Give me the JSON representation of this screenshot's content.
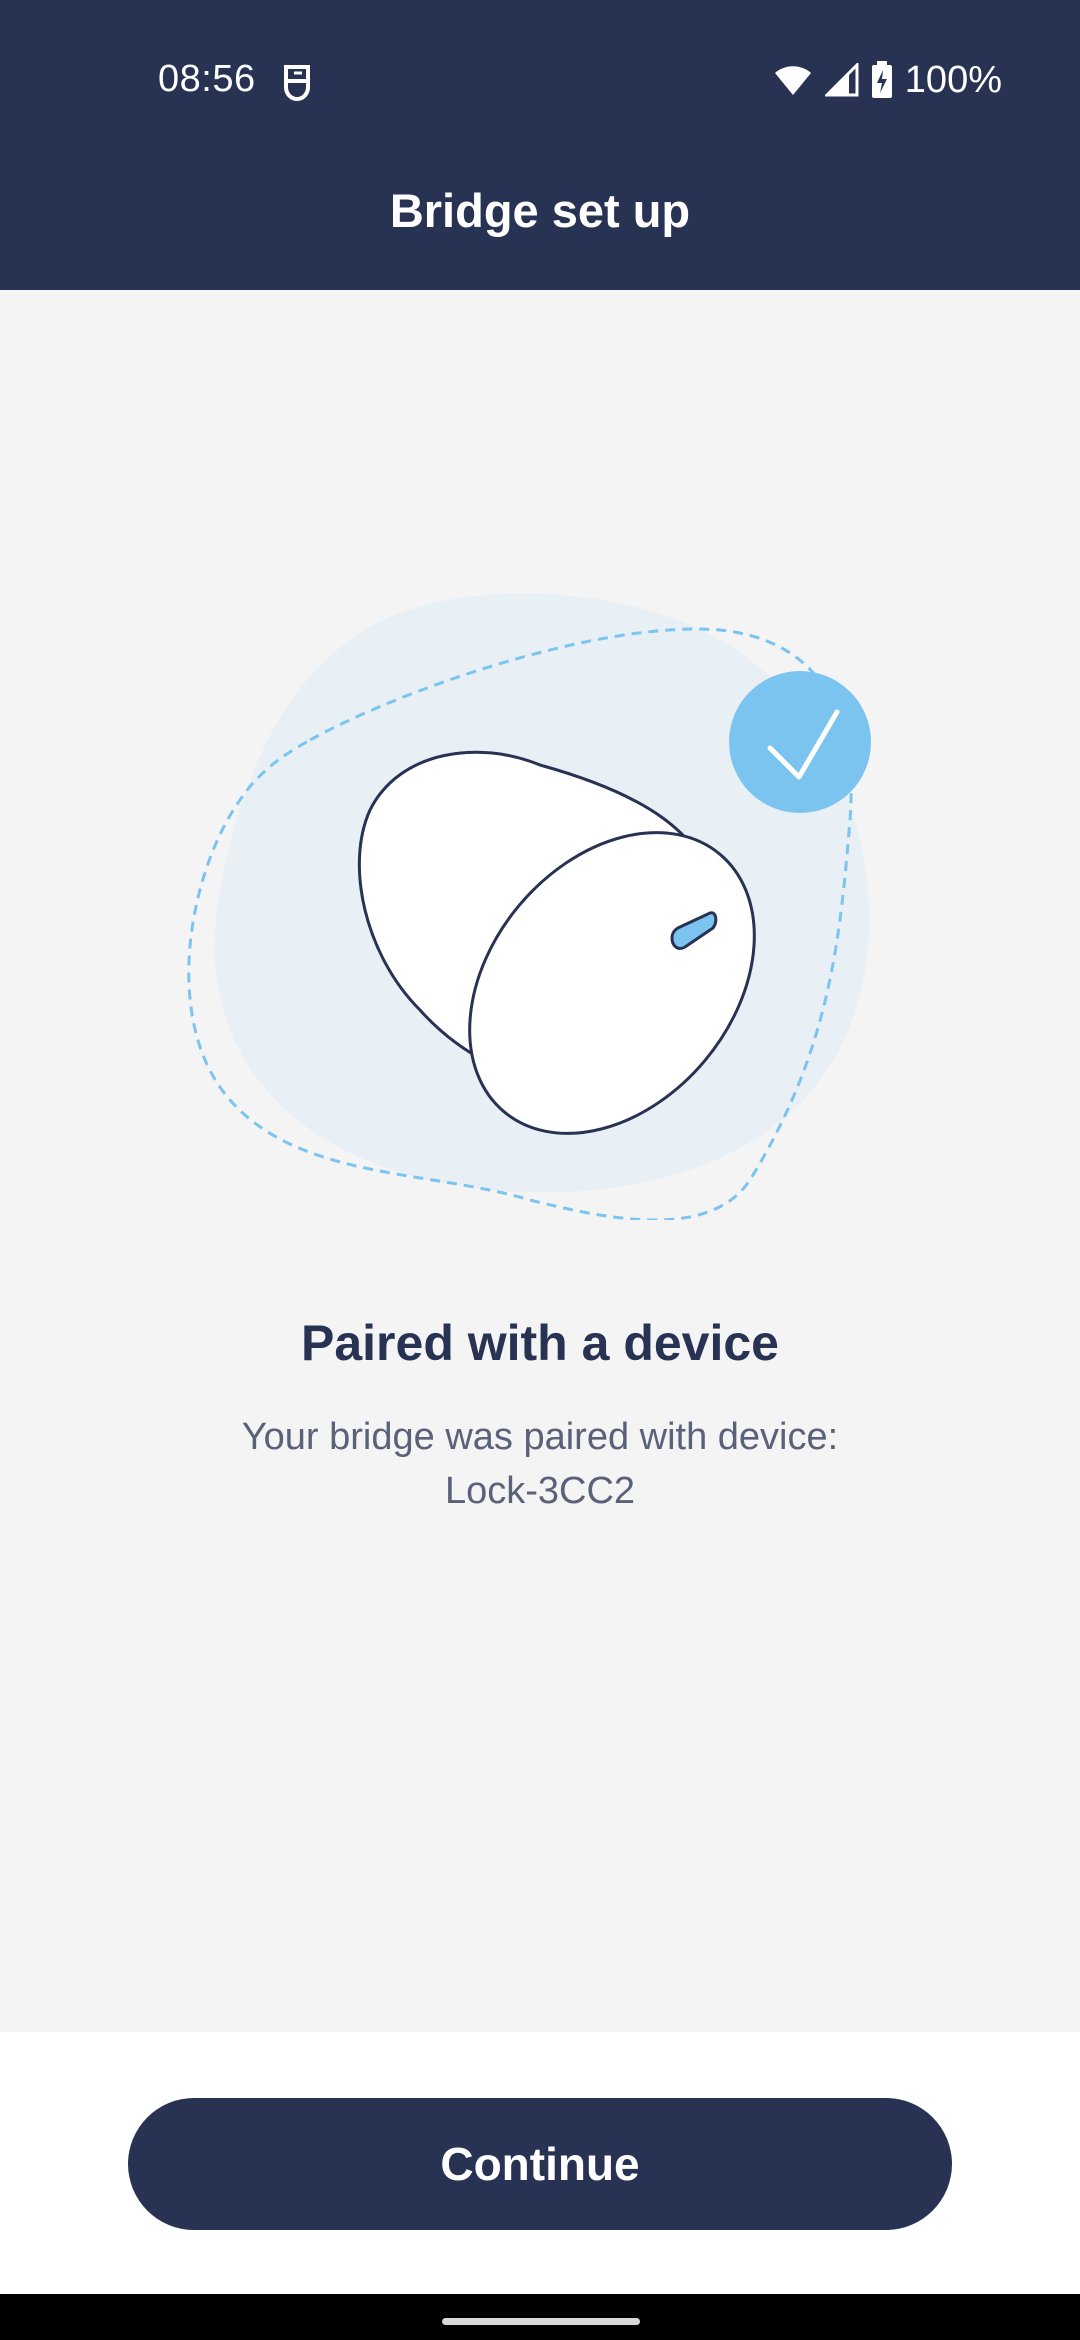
{
  "status_bar": {
    "time": "08:56",
    "battery": "100%",
    "left_icon": "accessibility-icon",
    "right_icons": [
      "wifi-icon",
      "signal-icon",
      "battery-charging-icon"
    ]
  },
  "header": {
    "title": "Bridge set up"
  },
  "illustration": {
    "icon": "lock-device-illustration",
    "badge_icon": "checkmark-icon"
  },
  "content": {
    "headline": "Paired with a device",
    "description_line1": "Your bridge was paired with device:",
    "description_line2": "Lock-3CC2"
  },
  "actions": {
    "continue_label": "Continue"
  },
  "colors": {
    "navy": "#283253",
    "accent_blue": "#7cc4f0",
    "blob_bg": "#e8f0f6",
    "screen_bg": "#f4f4f5"
  }
}
